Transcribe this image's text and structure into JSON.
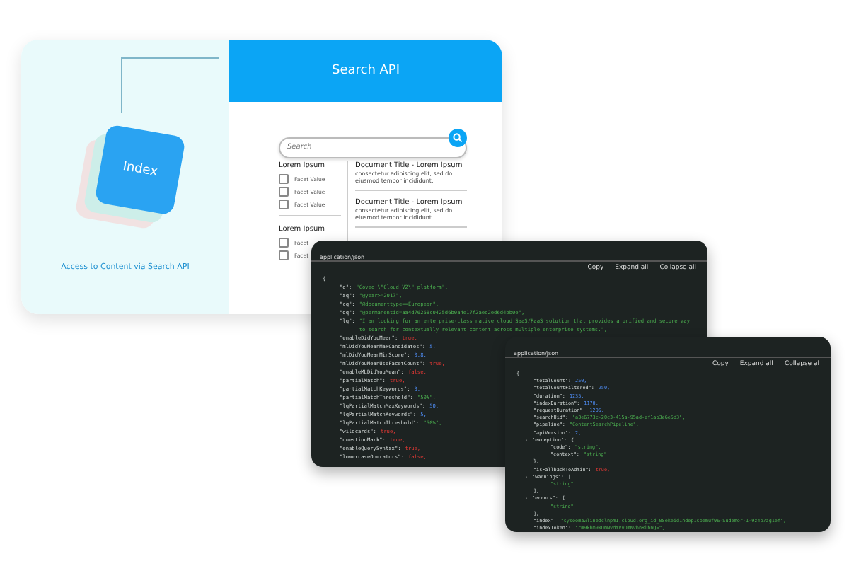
{
  "overview": {
    "caption": "Access to Content via Search API",
    "index_label": "Index"
  },
  "search_ui": {
    "title": "Search API",
    "search": {
      "placeholder": "Search"
    },
    "facet_groups": [
      {
        "heading": "Lorem Ipsum",
        "facets": [
          {
            "label": "Facet Value",
            "checked": false
          },
          {
            "label": "Facet Value",
            "checked": false
          },
          {
            "label": "Facet Value",
            "checked": false
          }
        ]
      },
      {
        "heading": "Lorem Ipsum",
        "facets": [
          {
            "label": "Facet",
            "checked": false
          },
          {
            "label": "Facet",
            "checked": false
          }
        ]
      }
    ],
    "results": [
      {
        "title": "Document Title - Lorem Ipsum",
        "snippet": "consectetur adipiscing elit, sed do eiusmod tempor incididunt."
      },
      {
        "title": "Document Title - Lorem Ipsum",
        "snippet": "consectetur adipiscing elit, sed do eiusmod tempor incididunt."
      }
    ]
  },
  "code_windows": [
    {
      "tab": "application/json",
      "actions": [
        "Copy",
        "Expand all",
        "Collapse all"
      ],
      "root": {
        "open": "{",
        "children": [
          {
            "key": "\"q\":",
            "value": "\"Coveo \\\"Cloud V2\\\" platform\",",
            "kind": "string"
          },
          {
            "key": "\"aq\":",
            "value": "\"@year>=2017\",",
            "kind": "string"
          },
          {
            "key": "\"cq\":",
            "value": "\"@documenttype==European\",",
            "kind": "string"
          },
          {
            "key": "\"dq\":",
            "value": "\"@permanentid=aa4d76268c0425d6b0a4e17f2aec2ed6d4bb0e\",",
            "kind": "string"
          },
          {
            "key": "\"lq\":",
            "value": "\"I am looking for an enterprise-class native cloud SaaS/PaaS solution that provides a unified and secure way to search for contextually relevant content across multiple enterprise systems.\",",
            "kind": "string"
          },
          {
            "key": "\"enableDidYouMean\":",
            "value": "true,",
            "kind": "boolean"
          },
          {
            "key": "\"mlDidYouMeanMaxCandidates\":",
            "value": "5,",
            "kind": "number"
          },
          {
            "key": "\"mlDidYouMeanMinScore\":",
            "value": "0.8,",
            "kind": "number"
          },
          {
            "key": "\"mlDidYouMeanUseFacetCount\":",
            "value": "true,",
            "kind": "boolean"
          },
          {
            "key": "\"enableMLDidYouMean\":",
            "value": "false,",
            "kind": "boolean"
          },
          {
            "key": "\"partialMatch\":",
            "value": "true,",
            "kind": "boolean"
          },
          {
            "key": "\"partialMatchKeywords\":",
            "value": "3,",
            "kind": "number"
          },
          {
            "key": "\"partialMatchThreshold\":",
            "value": "\"50%\",",
            "kind": "string"
          },
          {
            "key": "\"lqPartialMatchMaxKeywords\":",
            "value": "50,",
            "kind": "number"
          },
          {
            "key": "\"lqPartialMatchKeywords\":",
            "value": "5,",
            "kind": "number"
          },
          {
            "key": "\"lqPartialMatchThreshold\":",
            "value": "\"50%\",",
            "kind": "string"
          },
          {
            "key": "\"wildcards\":",
            "value": "true,",
            "kind": "boolean"
          },
          {
            "key": "\"questionMark\":",
            "value": "true,",
            "kind": "boolean"
          },
          {
            "key": "\"enableQuerySyntax\":",
            "value": "true,",
            "kind": "boolean"
          },
          {
            "key": "\"lowercaseOperators\":",
            "value": "false,",
            "kind": "boolean"
          }
        ]
      }
    },
    {
      "tab": "application/json",
      "actions": [
        "Copy",
        "Expand all",
        "Collapse al"
      ],
      "root": {
        "open": "{",
        "children": [
          {
            "key": "\"totalCount\":",
            "value": "250,",
            "kind": "number"
          },
          {
            "key": "\"totalCountFiltered\":",
            "value": "250,",
            "kind": "number"
          },
          {
            "key": "\"duration\":",
            "value": "1235,",
            "kind": "number"
          },
          {
            "key": "\"indexDuration\":",
            "value": "1170,",
            "kind": "number"
          },
          {
            "key": "\"requestDuration\":",
            "value": "1205,",
            "kind": "number"
          },
          {
            "key": "\"searchUid\":",
            "value": "\"a3e6773c-20c3-415a-95ad-ef1ab3e6e5d3\",",
            "kind": "string"
          },
          {
            "key": "\"pipeline\":",
            "value": "\"ContentSearchPipeline\",",
            "kind": "string"
          },
          {
            "key": "\"apiVersion\":",
            "value": "2,",
            "kind": "number"
          },
          {
            "key": "\"exception\":",
            "open": "{",
            "toggle": "-",
            "close": "},",
            "children": [
              {
                "key": "\"code\":",
                "value": "\"string\",",
                "kind": "string"
              },
              {
                "key": "\"context\":",
                "value": "\"string\"",
                "kind": "string"
              }
            ]
          },
          {
            "key": "\"isFallbackToAdmin\":",
            "value": "true,",
            "kind": "boolean"
          },
          {
            "key": "\"warnings\":",
            "open": "[",
            "toggle": "-",
            "close": "],",
            "children": [
              {
                "value": "\"string\"",
                "kind": "string"
              }
            ]
          },
          {
            "key": "\"errors\":",
            "open": "[",
            "toggle": "-",
            "close": "],",
            "children": [
              {
                "value": "\"string\"",
                "kind": "string"
              }
            ]
          },
          {
            "key": "\"index\":",
            "value": "\"sysoomawlinedclnpm1.cloud.org_id_0Sekeid1ndep1sbemuf96-Sudemor-1-9z4b7ag1ef\",",
            "kind": "string"
          },
          {
            "key": "\"indexToken\":",
            "value": "\"cm9kbm9kOmNvdmVvOmNvbnRlbnQ=\",",
            "kind": "string"
          }
        ]
      }
    }
  ]
}
